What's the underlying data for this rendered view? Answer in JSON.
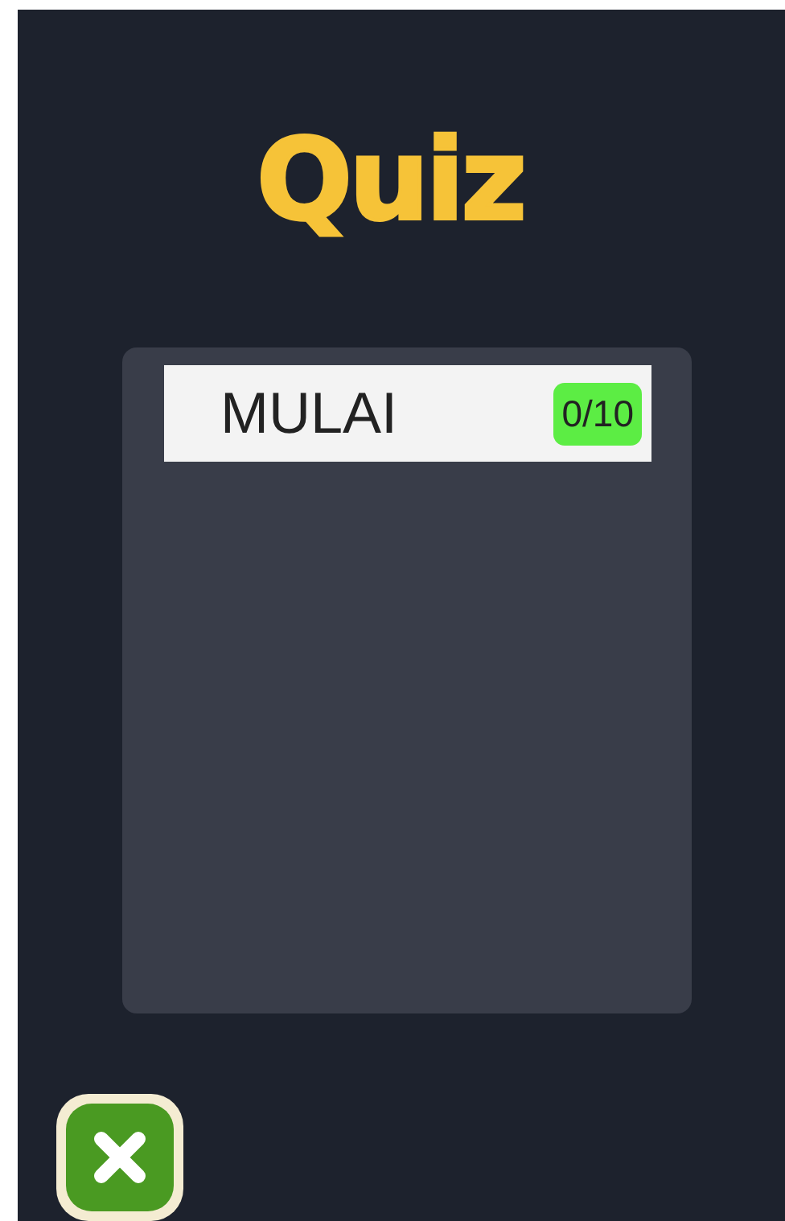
{
  "title": "Quiz",
  "items": [
    {
      "label": "MULAI",
      "score": "0/10"
    }
  ]
}
